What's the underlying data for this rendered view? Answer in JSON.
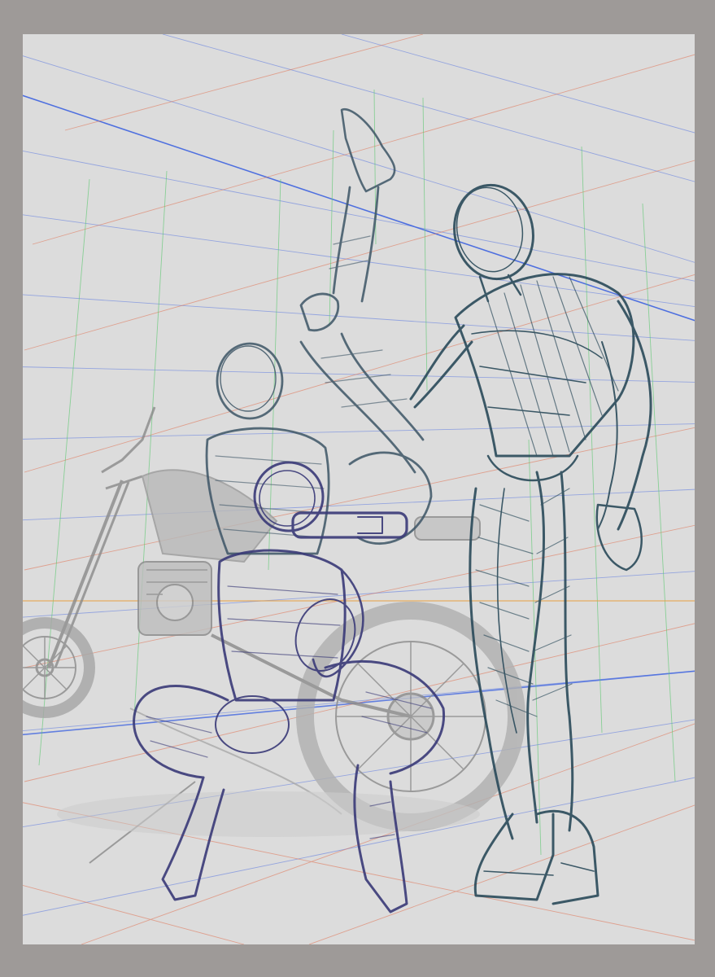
{
  "canvas": {
    "background_color": "#9e9a98",
    "paper_color": "#dcdcdc"
  },
  "artwork": {
    "subject": "",
    "colors": {
      "perspective_blue": "#5a78e0",
      "perspective_red": "#e07050",
      "vertical_green": "#5cc870",
      "horizon_orange": "#e8a040",
      "sketch_teal": "#2a4a5a",
      "sketch_purple": "#3a3a78",
      "motorcycle_gray": "#9a9a9a"
    }
  }
}
